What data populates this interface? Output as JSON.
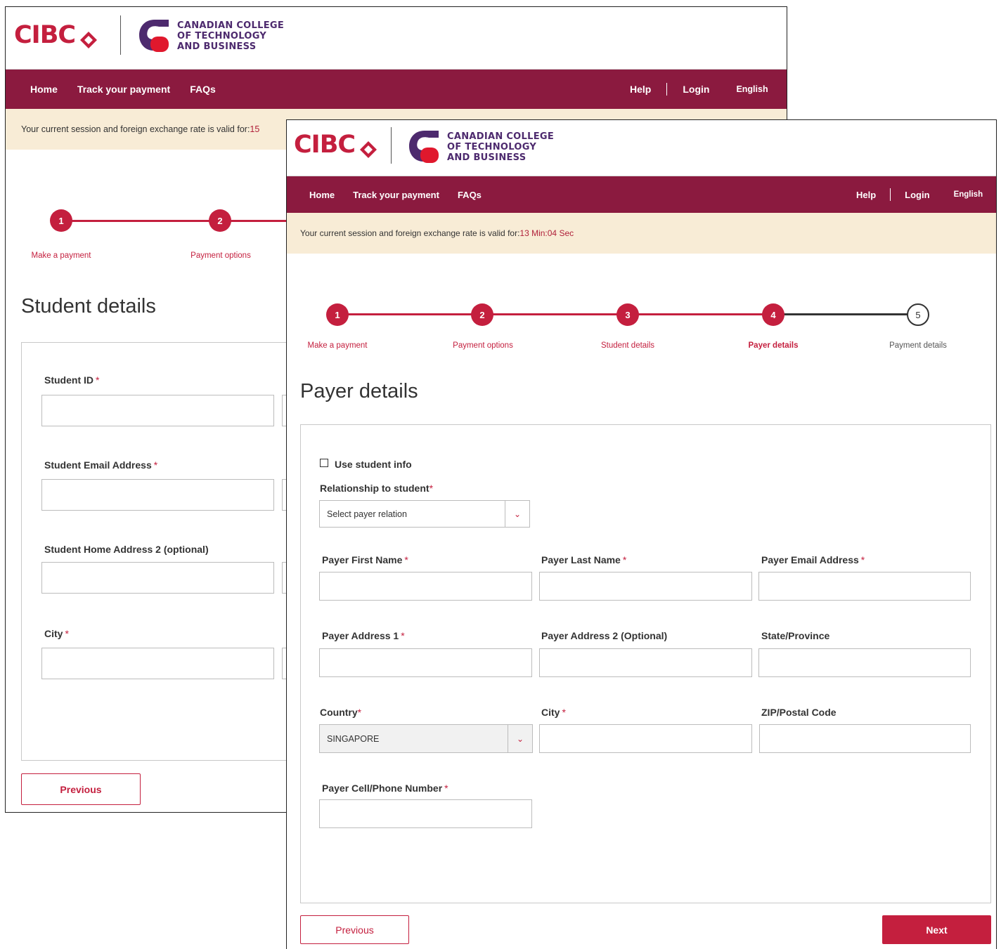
{
  "brand": {
    "bank_logo_text": "CIBC",
    "college_name_line1": "CANADIAN COLLEGE",
    "college_name_line2": "OF TECHNOLOGY",
    "college_name_line3": "AND BUSINESS"
  },
  "nav": {
    "home": "Home",
    "track": "Track your payment",
    "faqs": "FAQs",
    "help": "Help",
    "login": "Login",
    "language": "English"
  },
  "back_window": {
    "session_text": "Your current session and foreign exchange rate is valid for: ",
    "session_timer_partial": "15",
    "steps": [
      {
        "number": "1",
        "label": "Make a payment"
      },
      {
        "number": "2",
        "label": "Payment options"
      }
    ],
    "title": "Student details",
    "fields": {
      "student_id": "Student ID",
      "student_email": "Student Email Address",
      "home_address_2": "Student Home Address 2 (optional)",
      "city": "City"
    },
    "previous_button": "Previous"
  },
  "front_window": {
    "session_text": "Your current session and foreign exchange rate is valid for: ",
    "session_timer": "13 Min:04 Sec",
    "steps": [
      {
        "number": "1",
        "label": "Make a payment",
        "state": "done"
      },
      {
        "number": "2",
        "label": "Payment options",
        "state": "done"
      },
      {
        "number": "3",
        "label": "Student details",
        "state": "done"
      },
      {
        "number": "4",
        "label": "Payer details",
        "state": "active"
      },
      {
        "number": "5",
        "label": "Payment details",
        "state": "todo"
      }
    ],
    "title": "Payer details",
    "use_student_info": "Use student info",
    "relationship_label": "Relationship to student",
    "relationship_placeholder": "Select payer relation",
    "fields": {
      "first_name": "Payer First Name",
      "last_name": "Payer Last Name",
      "email": "Payer Email Address",
      "address1": "Payer Address 1",
      "address2": "Payer Address 2 (Optional)",
      "state": "State/Province",
      "country": "Country",
      "city": "City",
      "zip": "ZIP/Postal Code",
      "phone": "Payer Cell/Phone Number"
    },
    "country_value": "SINGAPORE",
    "previous_button": "Previous",
    "next_button": "Next"
  },
  "colors": {
    "brand_red": "#c41f3e",
    "nav_bg": "#8b1a3f",
    "session_bg": "#f8ecd6",
    "college_purple": "#4d2a6e"
  }
}
